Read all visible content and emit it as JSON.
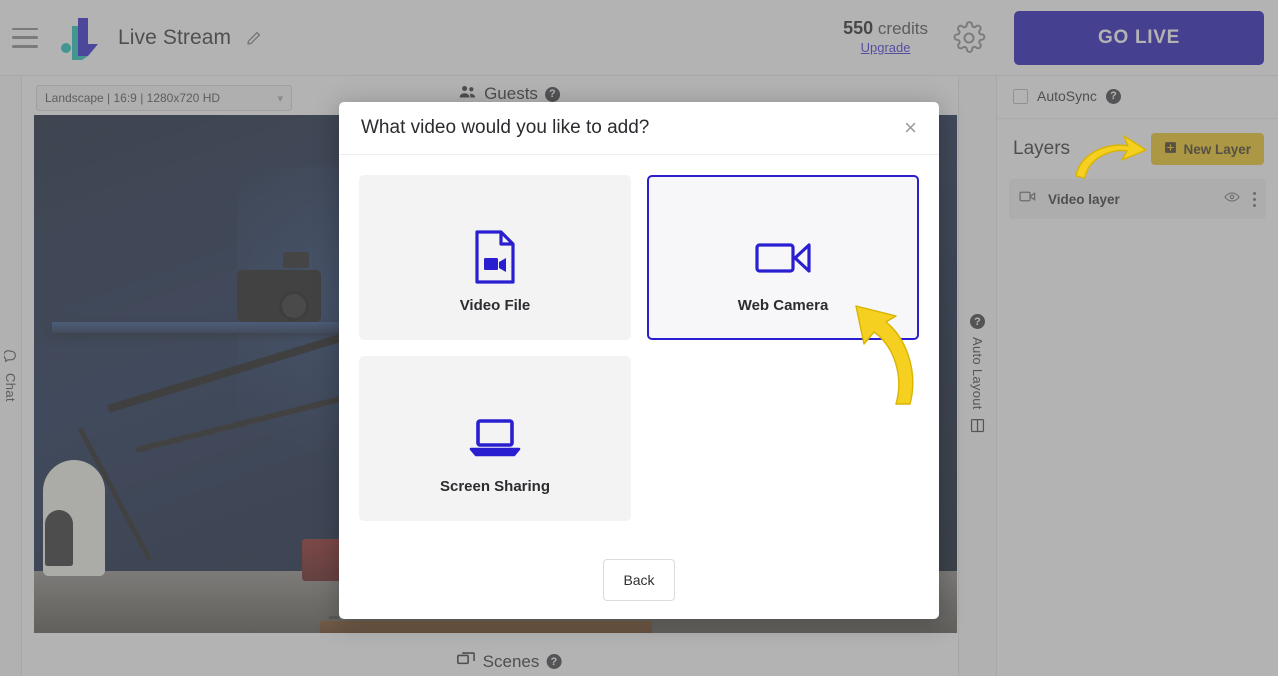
{
  "header": {
    "menu_icon": "hamburger-menu-icon",
    "logo_icon": "brand-logo-icon",
    "title": "Live Stream",
    "edit_icon": "pencil-edit-icon",
    "credits_amount": "550",
    "credits_label": "credits",
    "upgrade_label": "Upgrade",
    "settings_icon": "gear-icon",
    "go_live_label": "GO LIVE",
    "go_live_color": "#1a0fb5"
  },
  "left_rail": {
    "icon": "chat-bubble-icon",
    "label": "Chat"
  },
  "stage": {
    "ratio_value": "Landscape | 16:9 | 1280x720 HD",
    "ratio_caret": "chevron-down-icon",
    "guests_label": "Guests",
    "guests_icon": "people-group-icon",
    "guests_help": "?",
    "scenes_label": "Scenes",
    "scenes_icon": "scenes-screens-icon",
    "scenes_help": "?"
  },
  "right_rail": {
    "help": "?",
    "label": "Auto Layout",
    "icon": "layout-grid-icon"
  },
  "right_panel": {
    "autosync_label": "AutoSync",
    "autosync_help": "?",
    "autosync_checked": false,
    "layers_title": "Layers",
    "new_layer_label": "New Layer",
    "new_layer_icon": "plus-square-icon",
    "new_layer_color": "#f0c419",
    "layers": [
      {
        "icon": "video-camera-icon",
        "name": "Video layer",
        "visibility_icon": "eye-icon",
        "menu_icon": "kebab-menu-icon"
      }
    ]
  },
  "modal": {
    "title": "What video would you like to add?",
    "close_icon": "close-x-icon",
    "accent_color": "#2a1fd0",
    "options": [
      {
        "id": "video-file",
        "label": "Video File",
        "icon": "video-file-icon",
        "selected": false
      },
      {
        "id": "web-camera",
        "label": "Web Camera",
        "icon": "web-camera-icon",
        "selected": true
      },
      {
        "id": "screen-sharing",
        "label": "Screen Sharing",
        "icon": "laptop-screen-icon",
        "selected": false
      }
    ],
    "back_label": "Back"
  },
  "annotations": {
    "arrow_color": "#f5d020",
    "arrow_to_new_layer": "curved-arrow-pointing-to-new-layer-button",
    "arrow_to_web_camera": "curved-arrow-pointing-to-web-camera-card"
  }
}
